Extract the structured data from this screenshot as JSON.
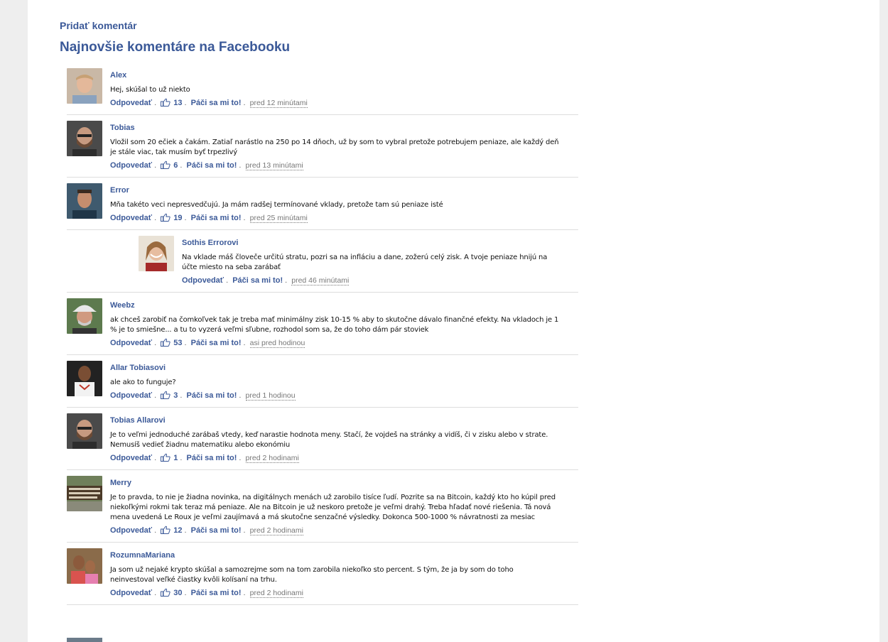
{
  "links": {
    "add_comment": "Pridať komentár"
  },
  "section_title": "Najnovšie komentáre na Facebooku",
  "labels": {
    "reply": "Odpovedať",
    "like": "Páči sa mi to!",
    "sep": "."
  },
  "comments": [
    {
      "name": "Alex",
      "text": "Hej, skúšal to už niekto",
      "likes": "13",
      "time": "pred 12 minútami"
    },
    {
      "name": "Tobias",
      "text": "Vložil som 20 ečiek a čakám. Zatiaľ narástlo na 250 po 14 dňoch, už by som to vybral pretože potrebujem peniaze, ale každý deň je stále viac, tak musím byť trpezlivý",
      "likes": "6",
      "time": "pred 13 minútami"
    },
    {
      "name": "Error",
      "text": "Mňa takéto veci nepresvedčujú. Ja mám radšej termínované vklady, pretože tam sú peniaze isté",
      "likes": "19",
      "time": "pred 25 minútami"
    },
    {
      "name": "Sothis Errorovi",
      "text": "Na vklade máš človeče určitú stratu, pozri sa na infláciu a dane, zožerú celý zisk. A tvoje peniaze hnijú na účte miesto na seba zarábať",
      "likes": "",
      "time": "pred 46 minútami"
    },
    {
      "name": "Weebz",
      "text": "ak chceš zarobiť na čomkoľvek tak je treba mať minimálny zisk 10-15 % aby to skutočne dávalo finančné efekty. Na vkladoch je 1 % je to smiešne... a tu to vyzerá veľmi sľubne, rozhodol som sa, že do toho dám pár stoviek",
      "likes": "53",
      "time": "asi pred hodinou"
    },
    {
      "name": "Allar Tobiasovi",
      "text": "ale ako to funguje?",
      "likes": "3",
      "time": "pred 1 hodinou"
    },
    {
      "name": "Tobias Allarovi",
      "text": "Je to veľmi jednoduché zarábaš vtedy, keď narastie hodnota meny. Stačí, že vojdeš na stránky a vidíš, či v zisku alebo v strate. Nemusíš vedieť žiadnu matematiku alebo ekonómiu",
      "likes": "1",
      "time": "pred 2 hodinami"
    },
    {
      "name": "Merry",
      "text": "Je to pravda, to nie je žiadna novinka, na digitálnych menách už zarobilo tisíce ľudí. Pozrite sa na Bitcoin, každý kto ho kúpil pred niekoľkými rokmi tak teraz má peniaze. Ale na Bitcoin je už neskoro pretože je veľmi drahý. Treba hľadať nové riešenia. Tá nová mena uvedená Le Roux je veľmi zaujímavá a má skutočne senzačné výsledky. Dokonca 500-1000 % návratnosti za mesiac",
      "likes": "12",
      "time": "pred 2 hodinami"
    },
    {
      "name": "RozumnaMariana",
      "text": "Ja som už nejaké krypto skúšal a samozrejme som na tom zarobila niekoľko sto percent. S tým, že ja by som do toho neinvestoval veľké čiastky kvôli kolísaní na trhu.",
      "likes": "30",
      "time": "pred 2 hodinami"
    }
  ],
  "colors": {
    "link": "#3b5998",
    "background": "#eeeeee",
    "panel": "#ffffff"
  },
  "icons": {
    "like": "thumbs-up-icon"
  }
}
